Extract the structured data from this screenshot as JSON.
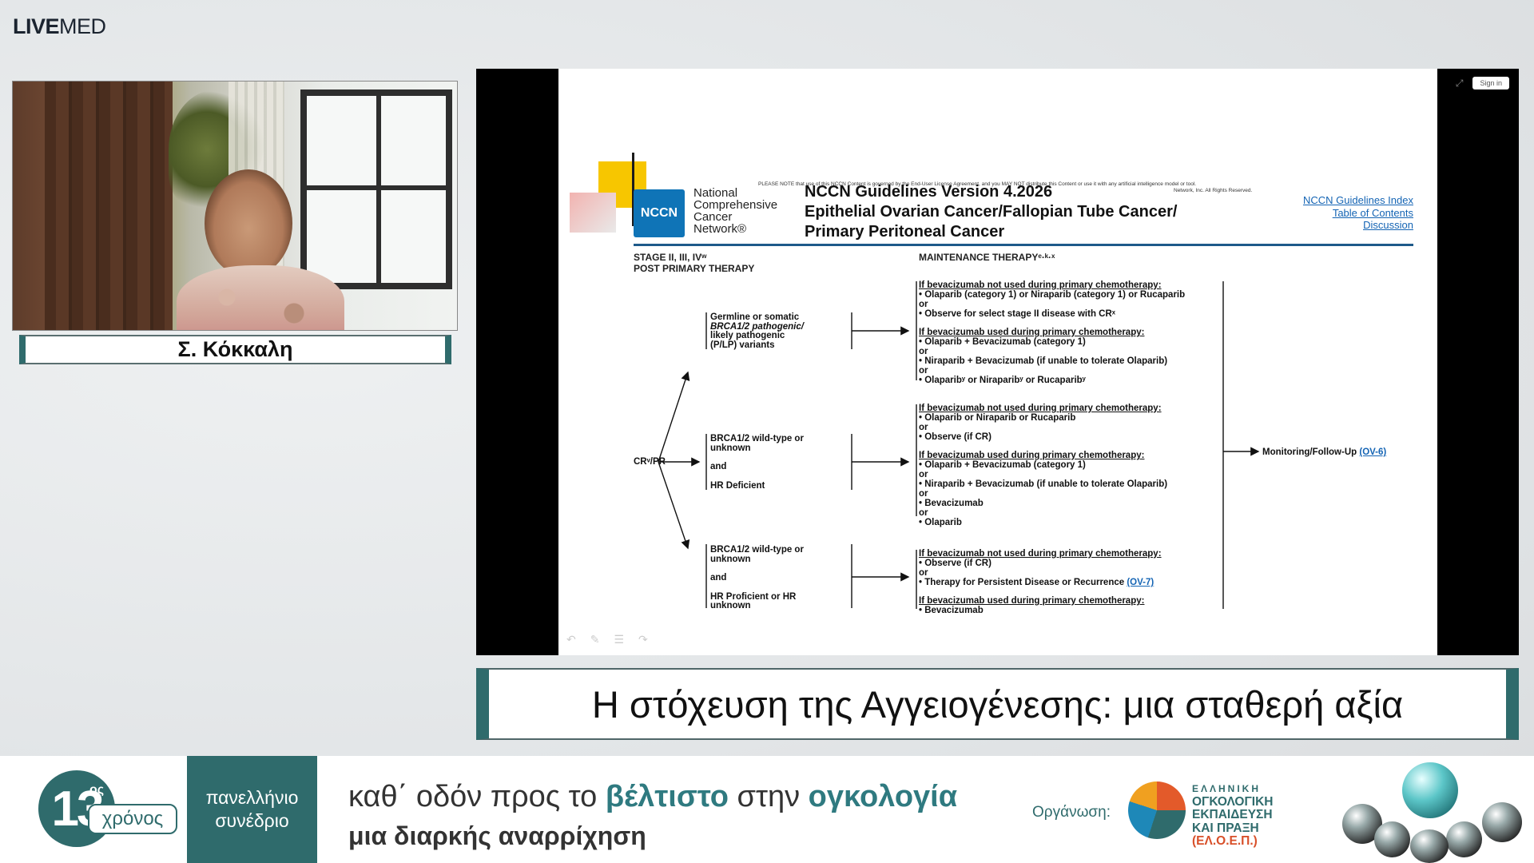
{
  "logo": {
    "bold": "LIVE",
    "light": "MED"
  },
  "speaker": {
    "name": "Σ. Κόκκαλη"
  },
  "slide_controls": {
    "signin_label": "Sign in",
    "expand_icon": "collapse-icon"
  },
  "slide": {
    "notice": "PLEASE NOTE that use of this NCCN Content is governed by the End-User License Agreement, and you MAY NOT distribute this Content or use it with any artificial intelligence model or tool.",
    "notice2": "Network, Inc. All Rights Reserved.",
    "org_lines": [
      "National",
      "Comprehensive",
      "Cancer",
      "Network®"
    ],
    "logo_text": "NCCN",
    "title_lines": [
      "NCCN Guidelines Version 4.2026",
      "Epithelial Ovarian Cancer/Fallopian Tube Cancer/",
      "Primary Peritoneal Cancer"
    ],
    "links": [
      "NCCN Guidelines Index",
      "Table of Contents",
      "Discussion"
    ],
    "stage_header": [
      "STAGE II, III, IVʷ",
      "POST PRIMARY THERAPY"
    ],
    "maint_header": "MAINTENANCE THERAPYᵉ·ᵏ·ˣ",
    "cr_label": "CRᵛ/PR",
    "branch1": [
      "Germline or somatic",
      "BRCA1/2 pathogenic/",
      "likely pathogenic",
      "(P/LP) variants"
    ],
    "branch2": [
      "BRCA1/2 wild-type or",
      "unknown",
      "and",
      "HR Deficient"
    ],
    "branch3": [
      "BRCA1/2 wild-type or",
      "unknown",
      "and",
      "HR Proficient or HR",
      "unknown"
    ],
    "b1_not_used": "If bevacizumab not used during primary chemotherapy:",
    "b1_opts_a": [
      "• Olaparib (category 1) or Niraparib (category 1) or Rucaparib",
      "or",
      "• Observe for select stage II disease with CRˣ"
    ],
    "b1_used": "If bevacizumab used during primary chemotherapy:",
    "b1_opts_b": [
      "• Olaparib + Bevacizumab (category 1)",
      "or",
      "• Niraparib + Bevacizumab (if unable to tolerate Olaparib)",
      "or",
      "• Olaparibʸ or Niraparibʸ or Rucaparibʸ"
    ],
    "b2_not_used": "If bevacizumab not used during primary chemotherapy:",
    "b2_opts_a": [
      "• Olaparib or Niraparib or Rucaparib",
      "or",
      "• Observe (if CR)"
    ],
    "b2_used": "If bevacizumab used during primary chemotherapy:",
    "b2_opts_b": [
      "• Olaparib + Bevacizumab (category 1)",
      "or",
      "• Niraparib + Bevacizumab (if unable to tolerate Olaparib)",
      "or",
      "• Bevacizumab",
      "or",
      "• Olaparib"
    ],
    "b3_not_used": "If bevacizumab not used during primary chemotherapy:",
    "b3_opts_a": [
      "• Observe (if CR)",
      "or"
    ],
    "b3_therapy": "• Therapy for Persistent Disease or Recurrence",
    "b3_therapy_link": "(OV-7)",
    "b3_used": "If bevacizumab used during primary chemotherapy:",
    "b3_opts_b": [
      "• Bevacizumab"
    ],
    "monitoring": "Monitoring/Follow-Up",
    "monitoring_link": "(OV-6)"
  },
  "title_bar": {
    "text": "Η στόχευση της Αγγειογένεσης: μια σταθερή αξία"
  },
  "banner": {
    "number": "13",
    "sup": "ος",
    "years": "χρόνος",
    "congress": [
      "πανελλήνιο",
      "συνέδριο"
    ],
    "tagline_pre": "καθ΄ οδόν προς το ",
    "tagline_hl1": "βέλτιστο",
    "tagline_mid": " στην ",
    "tagline_hl2": "ογκολογία",
    "tagline2": "μια διαρκής αναρρίχηση",
    "org_label": "Οργάνωση:",
    "org_lines": [
      "ΕΛΛΗΝΙΚΗ",
      "ΟΓΚΟΛΟΓΙΚΗ",
      "ΕΚΠΑΙΔΕΥΣΗ",
      "ΚΑΙ ΠΡΑΞΗ"
    ],
    "org_abbr": "(ΕΛ.Ο.Ε.Π.)"
  },
  "colors": {
    "accent": "#2f6b6c",
    "link": "#1464b4",
    "nccn_blue": "#0f74b7"
  }
}
